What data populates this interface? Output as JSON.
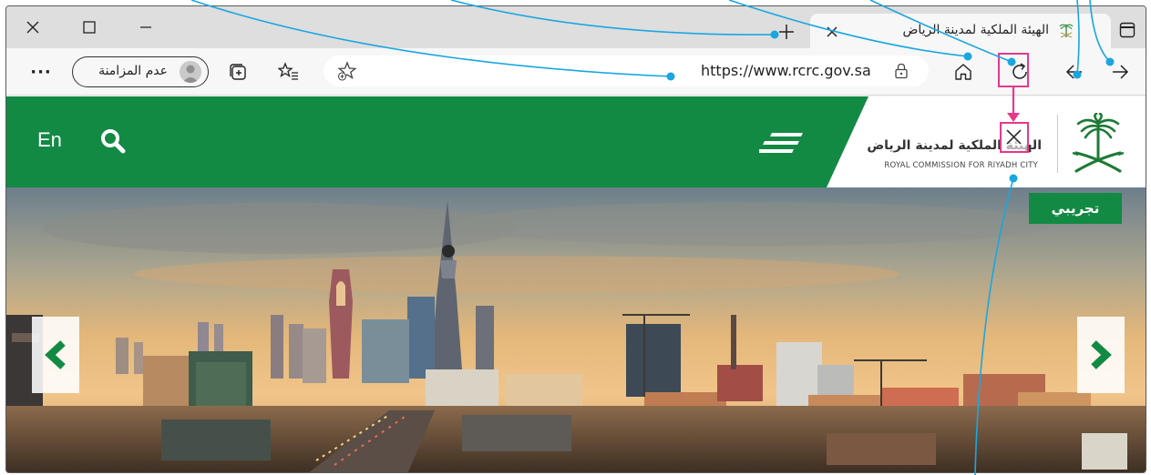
{
  "browser": {
    "tab_title": "الهيئة الملكية لمدينة الرياض",
    "url": "https://www.rcrc.gov.sa",
    "profile_label": "عدم المزامنة",
    "more_label": "···"
  },
  "site": {
    "lang_label": "En",
    "logo_arabic": "الهيئة الملكية لمدينة الرياض",
    "logo_english": "ROYAL COMMISSION FOR RIYADH CITY",
    "badge_label": "تجريبي"
  },
  "icons": {
    "close_window": "close-icon",
    "maximize": "square-icon",
    "minimize": "minus-icon",
    "new_tab": "plus-icon",
    "tab_close": "close-icon",
    "tab_actions": "tabs-icon",
    "more": "ellipsis-icon",
    "collections": "collections-icon",
    "favorites": "favorites-list-icon",
    "add_favorite": "star-add-icon",
    "lock": "lock-icon",
    "home": "home-icon",
    "refresh": "refresh-icon",
    "back": "arrow-left-icon",
    "forward": "arrow-right-icon",
    "search": "search-icon",
    "menu": "menu-icon",
    "stop": "close-icon",
    "prev_slide": "chevron-left-icon",
    "next_slide": "chevron-right-icon"
  },
  "colors": {
    "brand_green": "#128a44",
    "annotation_line": "#1aa6e0",
    "highlight": "#e6398b"
  }
}
